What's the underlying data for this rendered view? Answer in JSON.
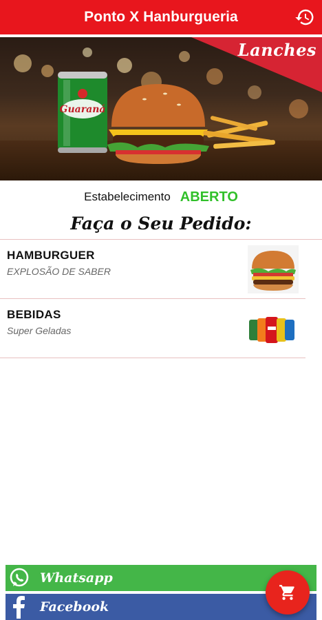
{
  "appbar": {
    "title": "Ponto X Hanburgueria",
    "history_icon": "history-icon"
  },
  "banner": {
    "ribbon_label": "Lanches",
    "can_text": "Guaraná"
  },
  "status": {
    "label": "Estabelecimento",
    "value": "ABERTO",
    "value_color": "#31c02a"
  },
  "order_heading": "Faça o Seu Pedido:",
  "categories": [
    {
      "title": "HAMBURGUER",
      "subtitle": "EXPLOSÃO DE SABER",
      "icon": "burger-icon"
    },
    {
      "title": "BEBIDAS",
      "subtitle": "Super Geladas",
      "icon": "soda-cans-icon"
    }
  ],
  "social": {
    "whatsapp_label": "Whatsapp",
    "whatsapp_color": "#44b648",
    "facebook_label": "Facebook",
    "facebook_color": "#3b5ba4"
  },
  "fab": {
    "icon": "cart-icon"
  },
  "colors": {
    "brand": "#e8161d",
    "divider": "#e8c0c0"
  }
}
